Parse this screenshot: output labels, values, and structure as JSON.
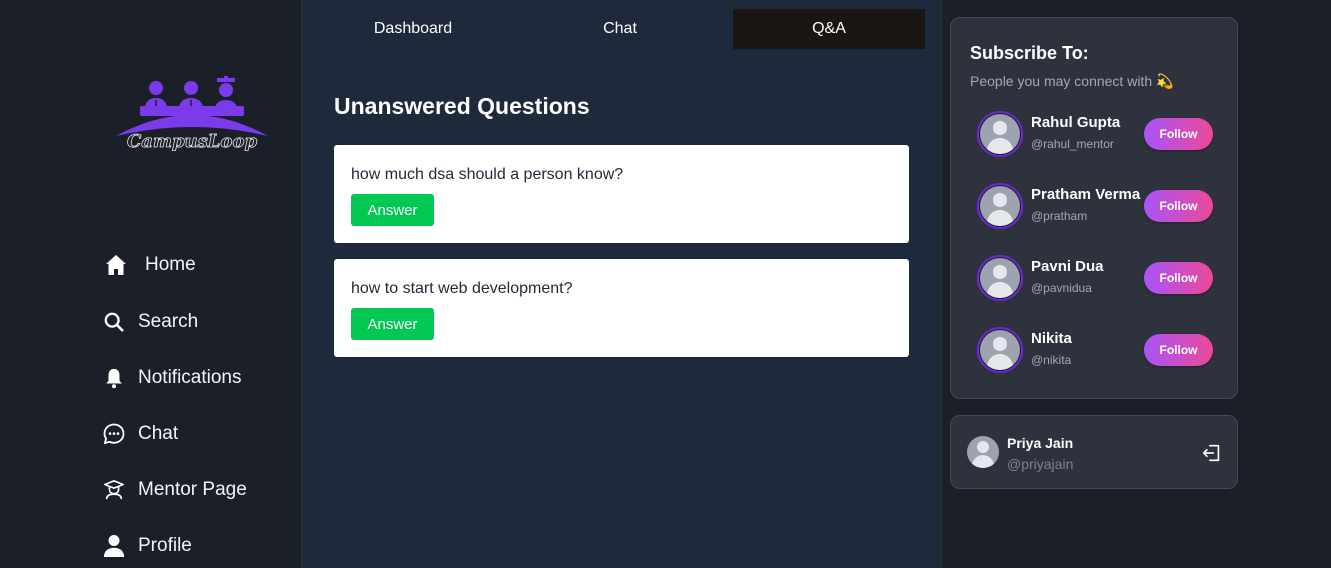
{
  "brand": {
    "name": "CampusLoop"
  },
  "sidebar": {
    "items": [
      {
        "label": "Home",
        "icon": "home-icon"
      },
      {
        "label": "Search",
        "icon": "search-icon"
      },
      {
        "label": "Notifications",
        "icon": "bell-icon"
      },
      {
        "label": "Chat",
        "icon": "chat-bubble-icon"
      },
      {
        "label": "Mentor Page",
        "icon": "mentor-icon"
      },
      {
        "label": "Profile",
        "icon": "user-icon"
      }
    ]
  },
  "tabs": [
    {
      "label": "Dashboard",
      "active": false
    },
    {
      "label": "Chat",
      "active": false
    },
    {
      "label": "Q&A",
      "active": true
    }
  ],
  "main": {
    "title": "Unanswered Questions",
    "questions": [
      {
        "text": "how much dsa should a person know?",
        "button": "Answer"
      },
      {
        "text": "how to start web development?",
        "button": "Answer"
      }
    ]
  },
  "subscribe": {
    "title": "Subscribe To:",
    "subtitle": "People you may connect with 💫",
    "people": [
      {
        "name": "Rahul Gupta",
        "handle": "@rahul_mentor",
        "button": "Follow"
      },
      {
        "name": "Pratham Verma",
        "handle": "@pratham",
        "button": "Follow"
      },
      {
        "name": "Pavni Dua",
        "handle": "@pavnidua",
        "button": "Follow"
      },
      {
        "name": "Nikita",
        "handle": "@nikita",
        "button": "Follow"
      }
    ]
  },
  "account": {
    "name": "Priya Jain",
    "handle": "@priyajain"
  },
  "colors": {
    "accent_purple": "#a855f7",
    "accent_pink": "#ec4899",
    "answer_green": "#00c853",
    "main_bg": "#1e293b",
    "sidebar_bg": "#1b1f27",
    "panel_bg": "#2e323d"
  }
}
